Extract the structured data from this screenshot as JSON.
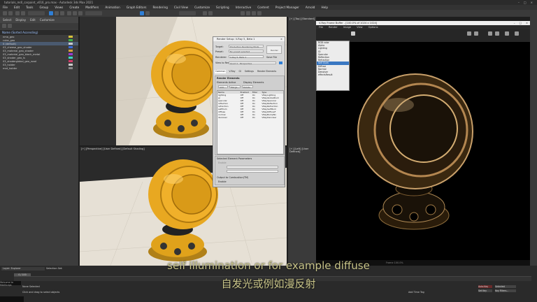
{
  "window": {
    "title": "tutorials_mdl_carpaint_v016_pro.max - Autodesk 3ds Max 2021",
    "controls": [
      "–",
      "□",
      "×"
    ]
  },
  "menu": [
    "File",
    "Edit",
    "Tools",
    "Group",
    "Views",
    "Create",
    "Modifiers",
    "Animation",
    "Graph Editors",
    "Rendering",
    "Civil View",
    "Customize",
    "Scripting",
    "Interactive",
    "Content",
    "Project Manager",
    "Arnold",
    "Help"
  ],
  "scene_explorer": {
    "tabs": [
      "Select",
      "Display",
      "Edit",
      "Customize"
    ],
    "header": "Name (Sorted Ascending)",
    "rows": [
      "nma_geo",
      "cube_geo",
      "0 (default)",
      "03_cheese_geo_shader",
      "03_material_geo_shader",
      "03_material_geo_black_metal",
      "03_shader_geo_ls",
      "03_shaderglobal_geo_road",
      "03_holder",
      "mat_holder"
    ]
  },
  "viewports": {
    "top_left": "[+] [Camera_ShaderBall] [Standard] [Default Shading]",
    "bottom_left": "[+] [Perspective] [User Defined] [Default Shading]",
    "right_top": "[+] [Top] [Standard]",
    "right_bottom": "[+] [Left] [User Defined]"
  },
  "render_setup": {
    "title": "Render Setup: V-Ray 5, Beta 1",
    "target_label": "Target:",
    "target_value": "Production Rendering Mode",
    "preset_label": "Preset:",
    "preset_value": "No preset selected",
    "renderer_label": "Renderer:",
    "renderer_value": "V-Ray 5, Beta 1",
    "save_file": "Save File",
    "view_label": "View to Render:",
    "view_value": "Quad 4 - Perspective",
    "render_button": "Render",
    "tabs": [
      "Common",
      "V-Ray",
      "GI",
      "Settings",
      "Render Elements"
    ],
    "rollout": "Render Elements",
    "elements_active": "Elements Active",
    "display_elements": "Display Elements",
    "add": "Add...",
    "merge": "Merge...",
    "delete": "Delete",
    "columns": [
      "Name",
      "Enabled",
      "Filter",
      "Type"
    ],
    "elements": [
      [
        "lighting",
        "Off",
        "On",
        "VRayLighting"
      ],
      [
        "gi",
        "Off",
        "On",
        "VRayGlobalIllum"
      ],
      [
        "specular",
        "Off",
        "On",
        "VRaySpecular"
      ],
      [
        "reflection",
        "Off",
        "On",
        "VRayReflection"
      ],
      [
        "refraction",
        "Off",
        "On",
        "VRayRefraction"
      ],
      [
        "selfIllum",
        "Off",
        "On",
        "VRaySelfIllum"
      ],
      [
        "diffuse",
        "Off",
        "On",
        "VRayDiffuseF"
      ],
      [
        "normal",
        "Off",
        "On",
        "VRayBumpNo"
      ],
      [
        "denoiser",
        "Off",
        "On",
        "VRayDenoiser"
      ]
    ],
    "selected_params": "Selected Element Parameters",
    "enable": "Enable",
    "output_combustion": "Output to Combustion(TM)",
    "enable2": "Enable"
  },
  "frame_buffer": {
    "title": "V-Ray Frame Buffer - [100.0% of 1024 x 1024]",
    "menu": [
      "File",
      "Render",
      "Image",
      "View",
      "Options"
    ],
    "channels": [
      "RGB color",
      "Alpha",
      "Lighting",
      "GI",
      "Specular",
      "Reflection",
      "Refraction",
      "Self Illum",
      "Diffuse",
      "Normal",
      "Denoiser",
      "effectsResult"
    ],
    "selected_channel": "Self Illum",
    "status": "Frame 100.0%",
    "controls": [
      "–",
      "□",
      "×"
    ]
  },
  "subtitles": {
    "en": "self illumination or for example diffuse",
    "zh": "自发光或例如漫反射"
  },
  "timeline": {
    "layer": "Layer: Explorer",
    "selection_set": "Selection Set:",
    "frame": "0 / 100",
    "status": "None Selected",
    "prompt": "Click and drag to select objects",
    "auto_key": "Auto Key",
    "selected": "Selected",
    "set_key": "Set Key",
    "key_filters": "Key Filters...",
    "add_time_tag": "Add Time Tag",
    "welcome": "Welcome to MAXScript."
  },
  "colors": {
    "accent": "#2f7fd6",
    "gold": "#e0a21b",
    "subtitle": "#c9c58a"
  }
}
